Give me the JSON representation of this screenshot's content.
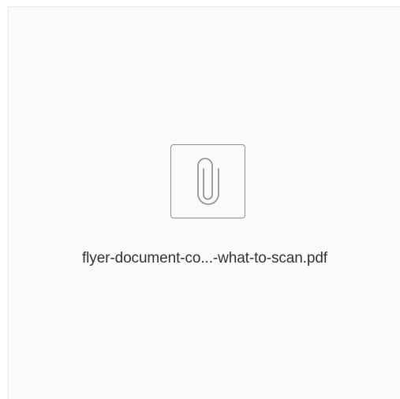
{
  "attachment": {
    "file_name": "flyer-document-co...-what-to-scan.pdf",
    "icon": "paperclip-icon"
  }
}
